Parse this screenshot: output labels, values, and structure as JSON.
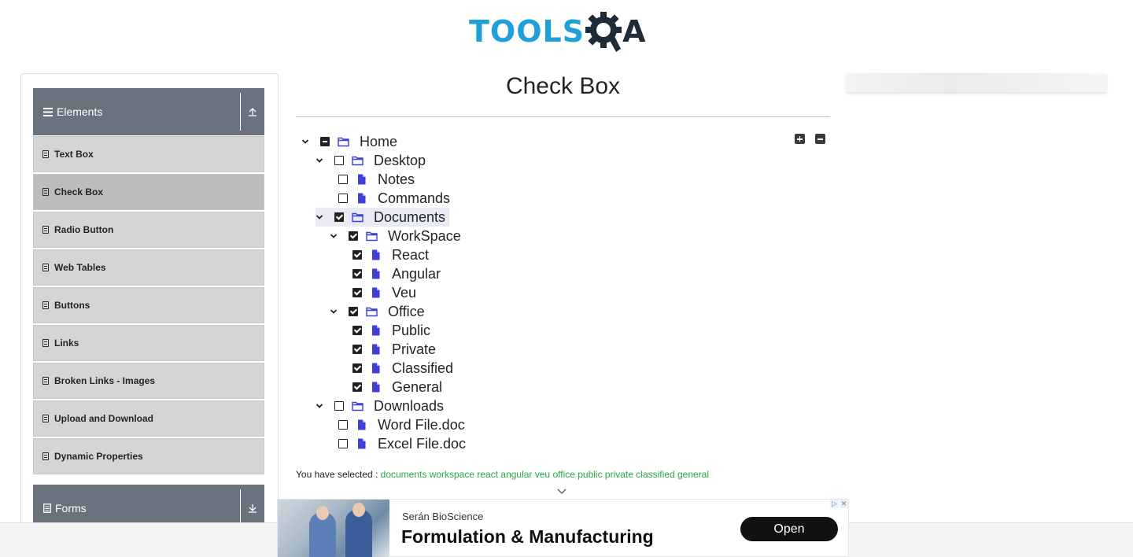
{
  "header": {
    "logo_text_left": "TOOLS",
    "logo_text_right": "A"
  },
  "sidebar": {
    "groups": [
      {
        "label": "Elements",
        "expanded": true
      },
      {
        "label": "Forms",
        "expanded": false
      }
    ],
    "items": [
      {
        "label": "Text Box",
        "active": false
      },
      {
        "label": "Check Box",
        "active": true
      },
      {
        "label": "Radio Button",
        "active": false
      },
      {
        "label": "Web Tables",
        "active": false
      },
      {
        "label": "Buttons",
        "active": false
      },
      {
        "label": "Links",
        "active": false
      },
      {
        "label": "Broken Links - Images",
        "active": false
      },
      {
        "label": "Upload and Download",
        "active": false
      },
      {
        "label": "Dynamic Properties",
        "active": false
      }
    ]
  },
  "main": {
    "title": "Check Box",
    "tree": [
      {
        "label": "Home",
        "state": "half",
        "type": "folder",
        "expandable": true
      },
      {
        "label": "Desktop",
        "state": "unchecked",
        "type": "folder",
        "expandable": true
      },
      {
        "label": "Notes",
        "state": "unchecked",
        "type": "file",
        "expandable": false
      },
      {
        "label": "Commands",
        "state": "unchecked",
        "type": "file",
        "expandable": false
      },
      {
        "label": "Documents",
        "state": "checked",
        "type": "folder",
        "expandable": true
      },
      {
        "label": "WorkSpace",
        "state": "checked",
        "type": "folder",
        "expandable": true
      },
      {
        "label": "React",
        "state": "checked",
        "type": "file",
        "expandable": false
      },
      {
        "label": "Angular",
        "state": "checked",
        "type": "file",
        "expandable": false
      },
      {
        "label": "Veu",
        "state": "checked",
        "type": "file",
        "expandable": false
      },
      {
        "label": "Office",
        "state": "checked",
        "type": "folder",
        "expandable": true
      },
      {
        "label": "Public",
        "state": "checked",
        "type": "file",
        "expandable": false
      },
      {
        "label": "Private",
        "state": "checked",
        "type": "file",
        "expandable": false
      },
      {
        "label": "Classified",
        "state": "checked",
        "type": "file",
        "expandable": false
      },
      {
        "label": "General",
        "state": "checked",
        "type": "file",
        "expandable": false
      },
      {
        "label": "Downloads",
        "state": "unchecked",
        "type": "folder",
        "expandable": true
      },
      {
        "label": "Word File.doc",
        "state": "unchecked",
        "type": "file",
        "expandable": false
      },
      {
        "label": "Excel File.doc",
        "state": "unchecked",
        "type": "file",
        "expandable": false
      }
    ],
    "result_prefix": "You have selected :",
    "result_items": "documents workspace react angular veu office public private classified general"
  },
  "ad": {
    "brand": "Serán BioScience",
    "headline": "Formulation & Manufacturing",
    "cta": "Open"
  },
  "colors": {
    "accent_blue": "#1fa0d8",
    "tree_icon": "#3f3fd8",
    "success_green": "#28a745",
    "sidebar_header": "#6a737d"
  }
}
